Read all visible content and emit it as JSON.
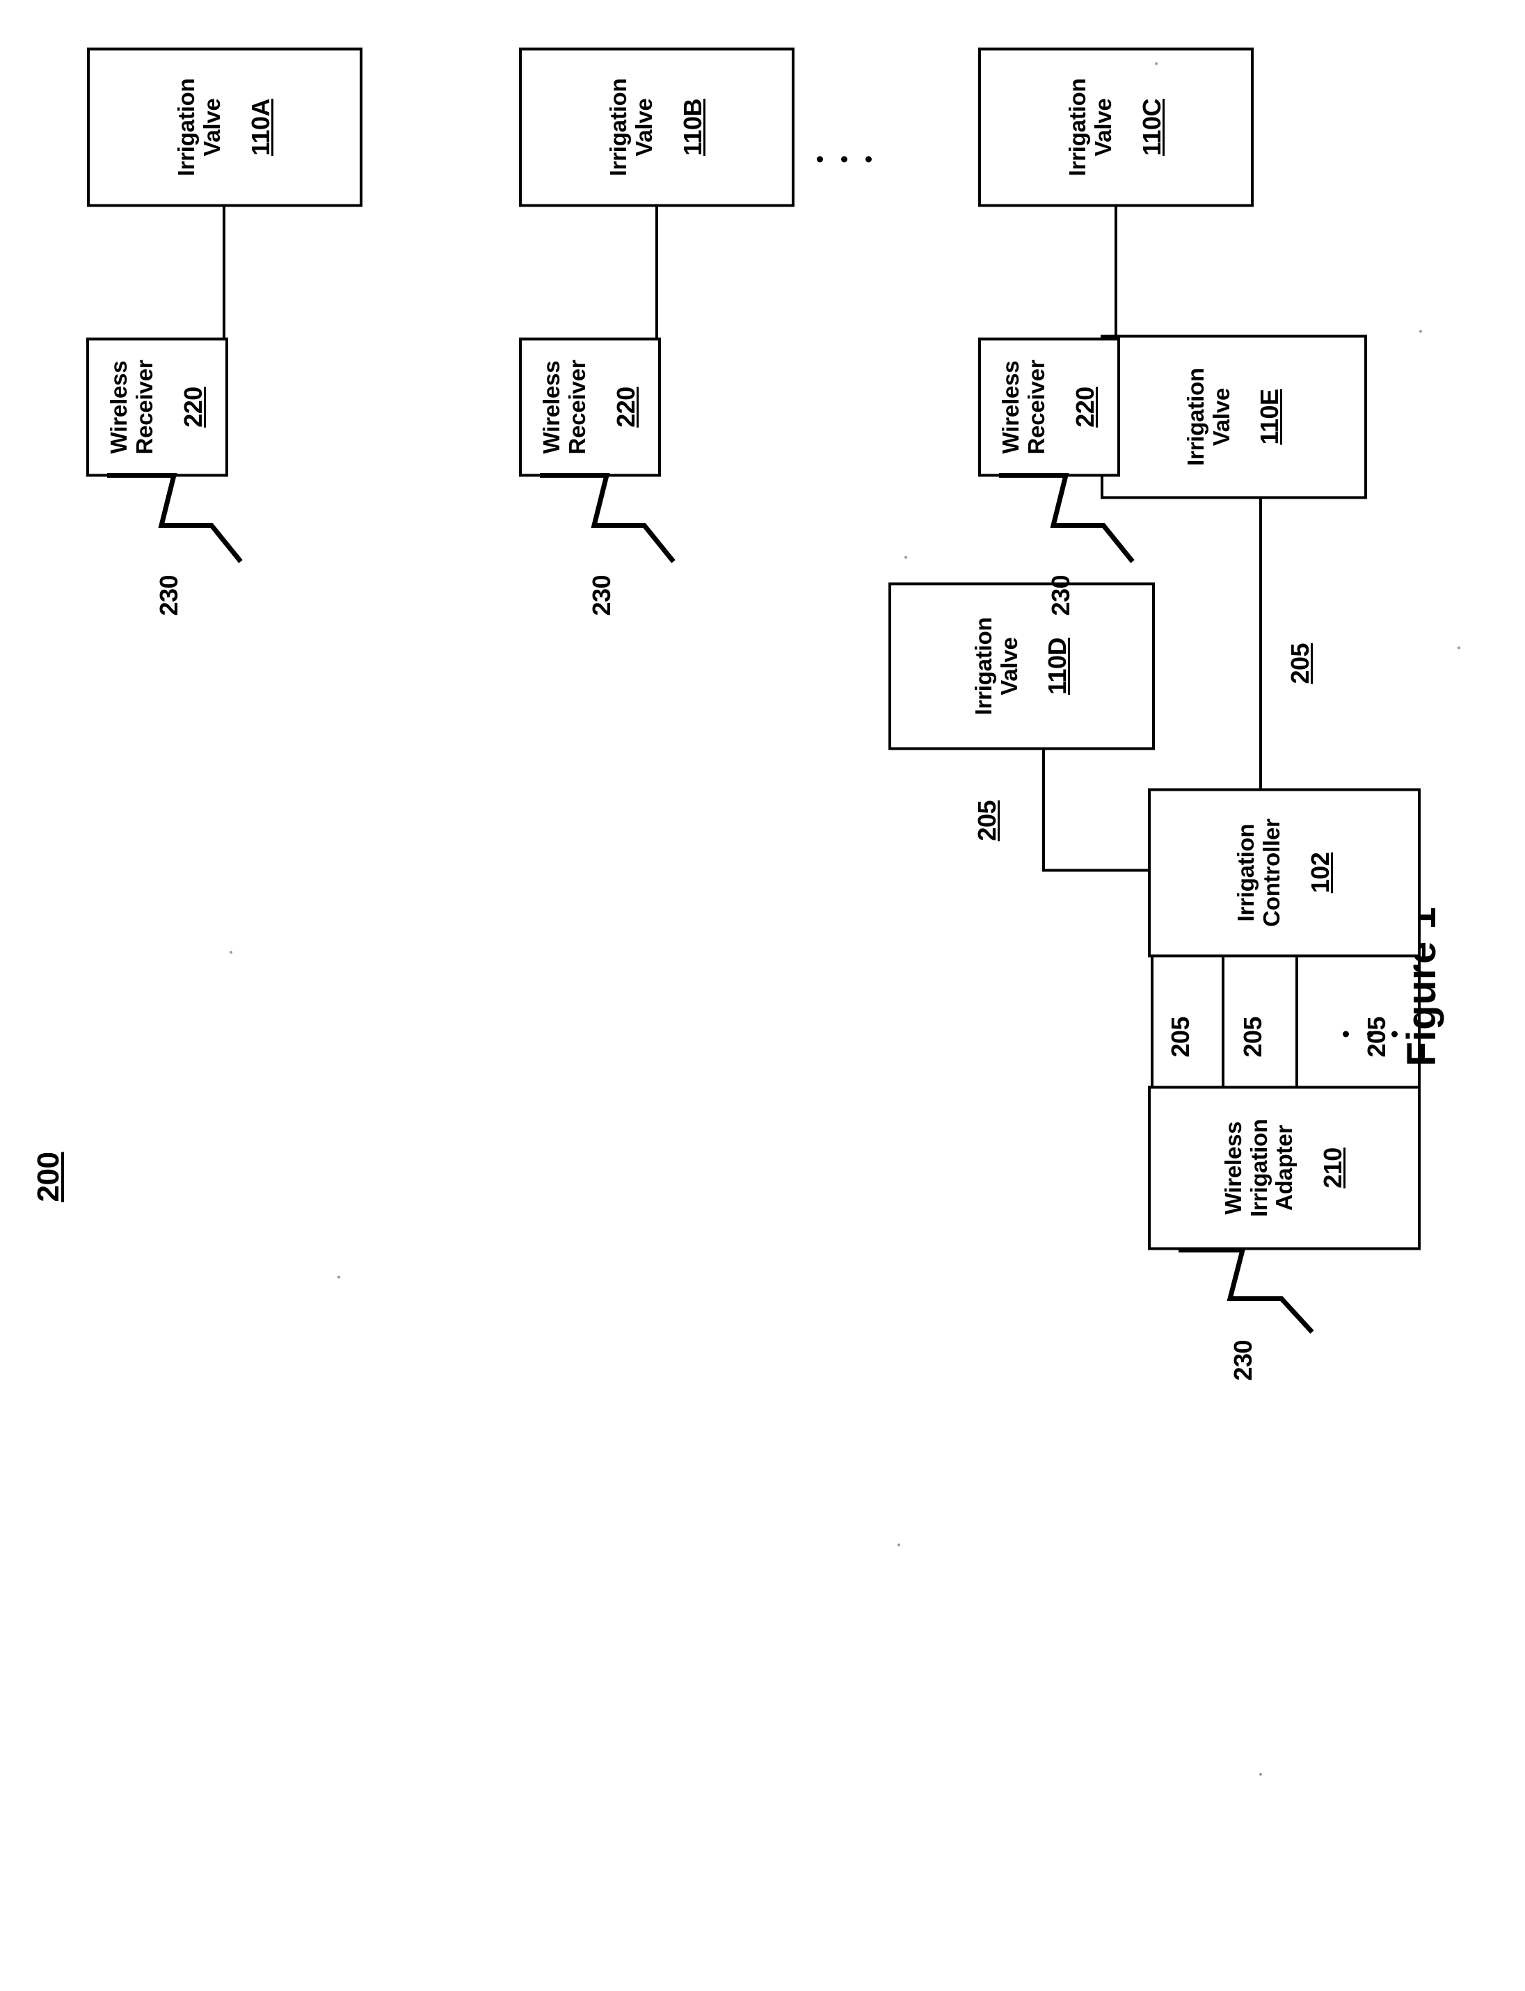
{
  "figure": {
    "label": "Figure 1",
    "system_number": "200"
  },
  "nodes": {
    "irrigation_controller": {
      "title": "Irrigation\nController",
      "ref": "102"
    },
    "wireless_irrigation_adapter": {
      "title": "Wireless\nIrrigation\nAdapter",
      "ref": "210"
    },
    "valve_d": {
      "title": "Irrigation\nValve",
      "ref": "110D"
    },
    "valve_e": {
      "title": "Irrigation\nValve",
      "ref": "110E"
    },
    "valve_a": {
      "title": "Irrigation\nValve",
      "ref": "110A"
    },
    "valve_b": {
      "title": "Irrigation\nValve",
      "ref": "110B"
    },
    "valve_c": {
      "title": "Irrigation\nValve",
      "ref": "110C"
    },
    "receiver_a": {
      "title": "Wireless\nReceiver",
      "ref": "220"
    },
    "receiver_b": {
      "title": "Wireless\nReceiver",
      "ref": "220"
    },
    "receiver_c": {
      "title": "Wireless\nReceiver",
      "ref": "220"
    }
  },
  "leads": {
    "adapter_wire_1": "205",
    "adapter_wire_2": "205",
    "adapter_wire_n": "205",
    "valve_d_wire": "205",
    "valve_e_wire": "205",
    "adapter_signal": "230",
    "receiver_a_signal": "230",
    "receiver_b_signal": "230",
    "receiver_c_signal": "230"
  },
  "colors": {
    "ink": "#000000",
    "paper": "#ffffff"
  },
  "icons": {
    "antenna": "antenna-zigzag-icon",
    "ellipsis": "ellipsis-dots-icon"
  }
}
